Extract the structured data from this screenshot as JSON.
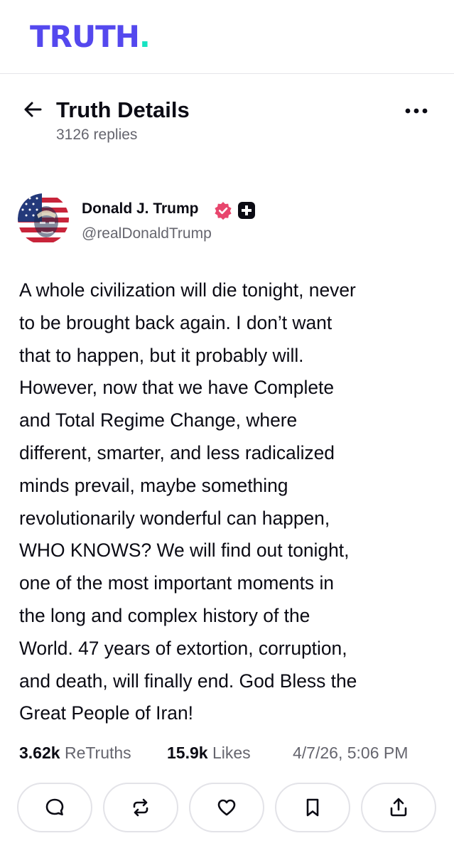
{
  "app": {
    "logo_text": "TRUTH",
    "logo_dot": ".",
    "brand_color": "#5448ee",
    "accent_color": "#17e3c2"
  },
  "header": {
    "title": "Truth Details",
    "reply_count": "3126 replies",
    "back_icon": "arrow-left-icon",
    "menu_icon": "more-horizontal-icon"
  },
  "author": {
    "name": "Donald J. Trump",
    "handle": "@realDonaldTrump",
    "verified_color": "#e8466d",
    "badge_icon": "plus-badge-icon"
  },
  "post": {
    "lines": [
      "A whole civilization will die tonight, never",
      "to be brought back again. I don’t want",
      "that to happen, but it probably will.",
      "However, now that we have Complete",
      "and Total Regime Change, where",
      "different, smarter, and less radicalized",
      "minds prevail, maybe something",
      "revolutionarily wonderful can happen,",
      "WHO KNOWS? We will find out tonight,",
      "one of the most important moments in",
      "the long and complex history of the",
      "World. 47 years of extortion, corruption,",
      "and death, will finally end. God Bless the",
      "Great People of Iran!"
    ]
  },
  "stats": {
    "retruths_count": "3.62k",
    "retruths_label": "ReTruths",
    "likes_count": "15.9k",
    "likes_label": "Likes",
    "timestamp": "4/7/26, 5:06 PM"
  },
  "actions": [
    {
      "icon": "comment-icon"
    },
    {
      "icon": "retruth-icon"
    },
    {
      "icon": "heart-icon"
    },
    {
      "icon": "bookmark-icon"
    },
    {
      "icon": "share-icon"
    }
  ]
}
